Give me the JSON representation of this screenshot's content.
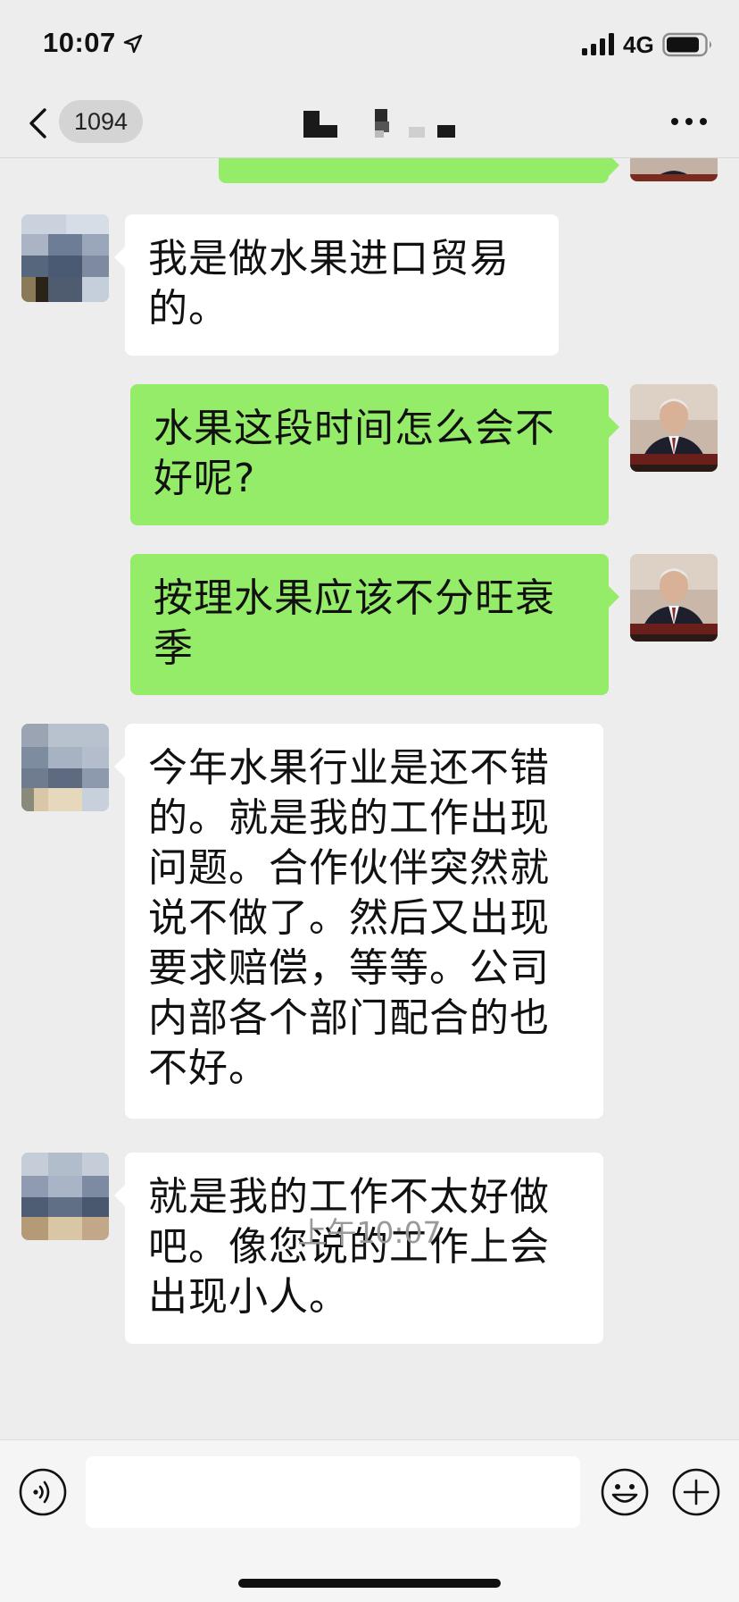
{
  "status_bar": {
    "time": "10:07",
    "network": "4G"
  },
  "nav": {
    "unread_count": "1094"
  },
  "messages": [
    {
      "direction": "incoming",
      "text": "我是做水果进口贸易的。"
    },
    {
      "direction": "outgoing",
      "text": "水果这段时间怎么会不好呢?"
    },
    {
      "direction": "outgoing",
      "text": "按理水果应该不分旺衰季"
    },
    {
      "direction": "incoming",
      "text": "今年水果行业是还不错的。就是我的工作出现问题。合作伙伴突然就说不做了。然后又出现要求赔偿，等等。公司内部各个部门配合的也不好。"
    },
    {
      "direction": "incoming",
      "text": "就是我的工作不太好做吧。像您说的工作上会出现小人。"
    }
  ],
  "timestamp": "上午10:07",
  "colors": {
    "background": "#ededed",
    "outgoing_bubble": "#95ec69",
    "incoming_bubble": "#ffffff",
    "timestamp_text": "#9a9a9a"
  },
  "icons": {
    "back": "chevron-left-icon",
    "more": "more-dots-icon",
    "voice": "voice-icon",
    "emoji": "emoji-icon",
    "plus": "plus-icon"
  }
}
